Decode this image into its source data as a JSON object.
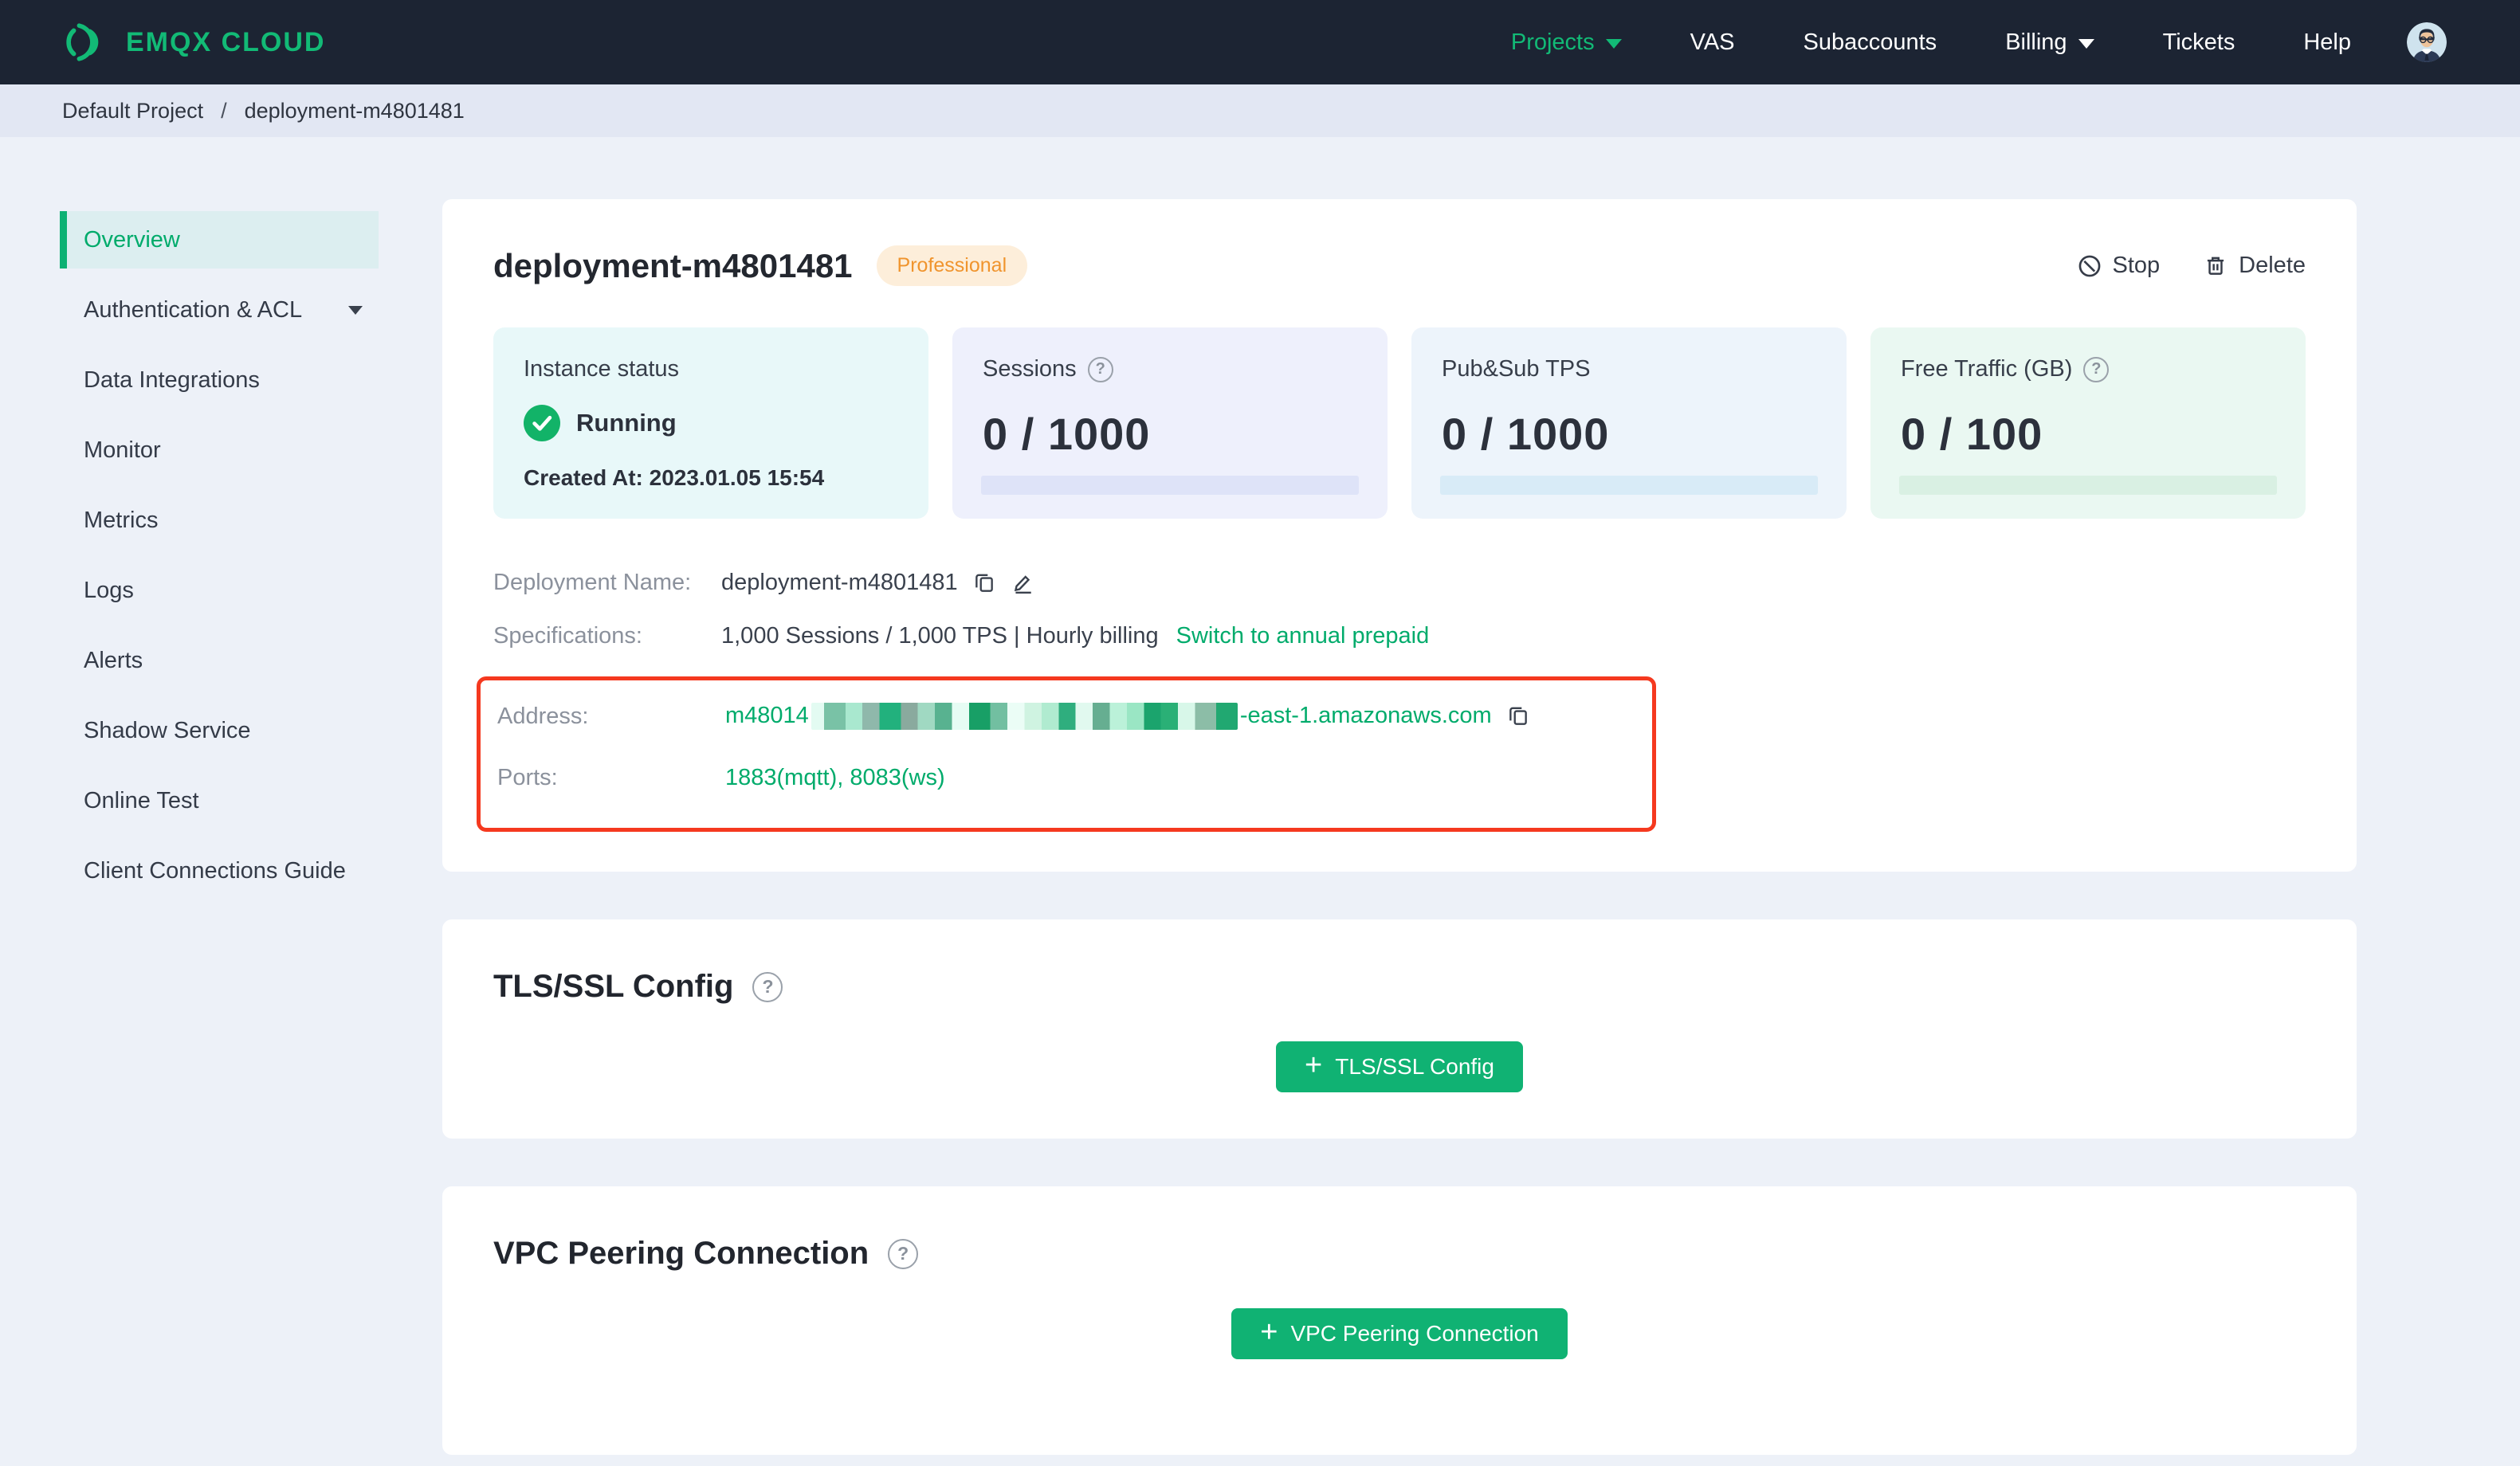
{
  "nav": {
    "brand": "EMQX CLOUD",
    "projects": "Projects",
    "vas": "VAS",
    "subaccounts": "Subaccounts",
    "billing": "Billing",
    "tickets": "Tickets",
    "help": "Help"
  },
  "breadcrumb": {
    "project": "Default Project",
    "separator": "/",
    "page": "deployment-m4801481"
  },
  "sidebar": {
    "items": [
      {
        "label": "Overview",
        "active": true
      },
      {
        "label": "Authentication & ACL",
        "caret": true
      },
      {
        "label": "Data Integrations"
      },
      {
        "label": "Monitor"
      },
      {
        "label": "Metrics"
      },
      {
        "label": "Logs"
      },
      {
        "label": "Alerts"
      },
      {
        "label": "Shadow Service"
      },
      {
        "label": "Online Test"
      },
      {
        "label": "Client Connections Guide"
      }
    ]
  },
  "overview": {
    "title": "deployment-m4801481",
    "badge": "Professional",
    "actions": {
      "stop": "Stop",
      "delete": "Delete"
    },
    "stats": {
      "instance": {
        "label": "Instance status",
        "status": "Running",
        "created": "Created At: 2023.01.05 15:54"
      },
      "sessions": {
        "label": "Sessions",
        "value": "0 / 1000"
      },
      "tps": {
        "label": "Pub&Sub TPS",
        "value": "0 / 1000"
      },
      "traffic": {
        "label": "Free Traffic (GB)",
        "value": "0 / 100"
      }
    },
    "info": {
      "deployment_name_label": "Deployment Name:",
      "deployment_name": "deployment-m4801481",
      "specifications_label": "Specifications:",
      "specifications": "1,000 Sessions / 1,000 TPS | Hourly billing",
      "switch_link": "Switch to annual prepaid",
      "address_label": "Address:",
      "address_prefix": "m48014",
      "address_redacted": true,
      "address_suffix": "-east-1.amazonaws.com",
      "ports_label": "Ports:",
      "ports": "1883(mqtt), 8083(ws)"
    }
  },
  "tls": {
    "heading": "TLS/SSL Config",
    "button": "TLS/SSL Config"
  },
  "vpc": {
    "heading": "VPC Peering Connection",
    "button": "VPC Peering Connection"
  },
  "icons": {
    "question": "?",
    "plus": "+"
  },
  "colors": {
    "accent_green": "#00ab6b",
    "brand_green": "#12ba76",
    "button_green": "#10b273",
    "nav_bg": "#1c2433",
    "page_bg": "#edf1f8",
    "breadcrumb_bg": "#e2e7f3",
    "badge_text": "#f0942d",
    "badge_bg": "#fdeeda",
    "annotation_red": "#f5391f",
    "status_ok": "#12b368"
  }
}
